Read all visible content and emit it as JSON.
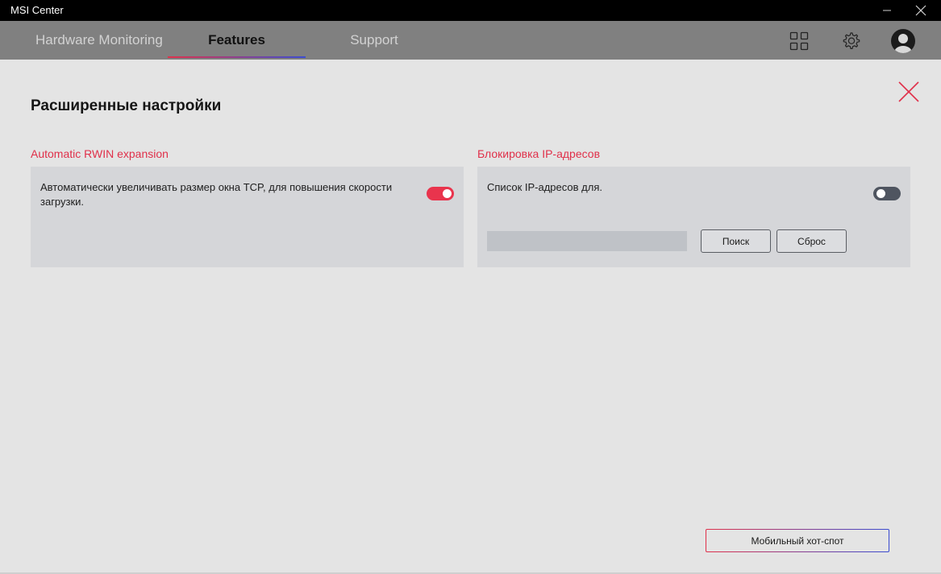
{
  "window": {
    "title": "MSI Center"
  },
  "nav": {
    "tabs": [
      {
        "label": "Hardware Monitoring",
        "active": false
      },
      {
        "label": "Features",
        "active": true
      },
      {
        "label": "Support",
        "active": false
      }
    ],
    "icons": [
      "grid-icon",
      "gear-icon",
      "avatar-icon"
    ]
  },
  "page": {
    "title": "Расширенные настройки",
    "close_icon": "close-icon"
  },
  "rwin": {
    "title": "Automatic RWIN expansion",
    "description": "Автоматически увеличивать размер окна TCP, для повышения скорости загрузки.",
    "enabled": true
  },
  "ip_block": {
    "title": "Блокировка IP-адресов",
    "description": "Список IP-адресов для.",
    "enabled": false,
    "input_value": "",
    "search_label": "Поиск",
    "reset_label": "Сброс"
  },
  "footer": {
    "hotspot_label": "Мобильный хот-спот"
  },
  "colors": {
    "accent_red": "#e9344d",
    "accent_blue": "#3a4bd0",
    "toggle_off": "#4f5560",
    "navbar": "#808080",
    "background": "#e4e4e4",
    "card": "#d5d6d9"
  }
}
